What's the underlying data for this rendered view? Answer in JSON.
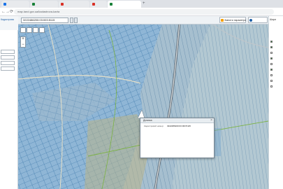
{
  "browser": {
    "address": "map.land.gov.ua/kadastrova-karta",
    "new_tab_symbol": "+",
    "nav": {
      "back": "←",
      "forward": "→",
      "reload": "⟳"
    }
  },
  "left_panel": {
    "side_labels": [
      "Кадастрова"
    ]
  },
  "map_toolbar": {
    "cadastral_number": "3222486200:03:003:5115",
    "reset_label": "Змінити параметри"
  },
  "zoom": {
    "in": "+",
    "out": "−"
  },
  "popup": {
    "title": "Ділянка",
    "close": "×",
    "fields": [
      {
        "label": "Кадастровий номер:",
        "value": "3222486200:03:003:5115"
      }
    ],
    "links": []
  },
  "right_panel": {
    "title": "Шари",
    "layers": [
      {
        "label": "",
        "checked": true
      },
      {
        "label": "",
        "checked": true
      },
      {
        "label": "",
        "checked": false
      },
      {
        "label": "",
        "checked": true
      },
      {
        "label": "",
        "checked": false
      },
      {
        "label": "",
        "checked": true
      },
      {
        "label": "",
        "checked": false
      },
      {
        "label": "",
        "checked": false
      },
      {
        "label": "",
        "checked": false
      }
    ]
  },
  "colors": {
    "parcel_fill": "#8fb6d6",
    "parcel_stroke": "#2f6ea3",
    "popup_border": "#7a8a96"
  }
}
